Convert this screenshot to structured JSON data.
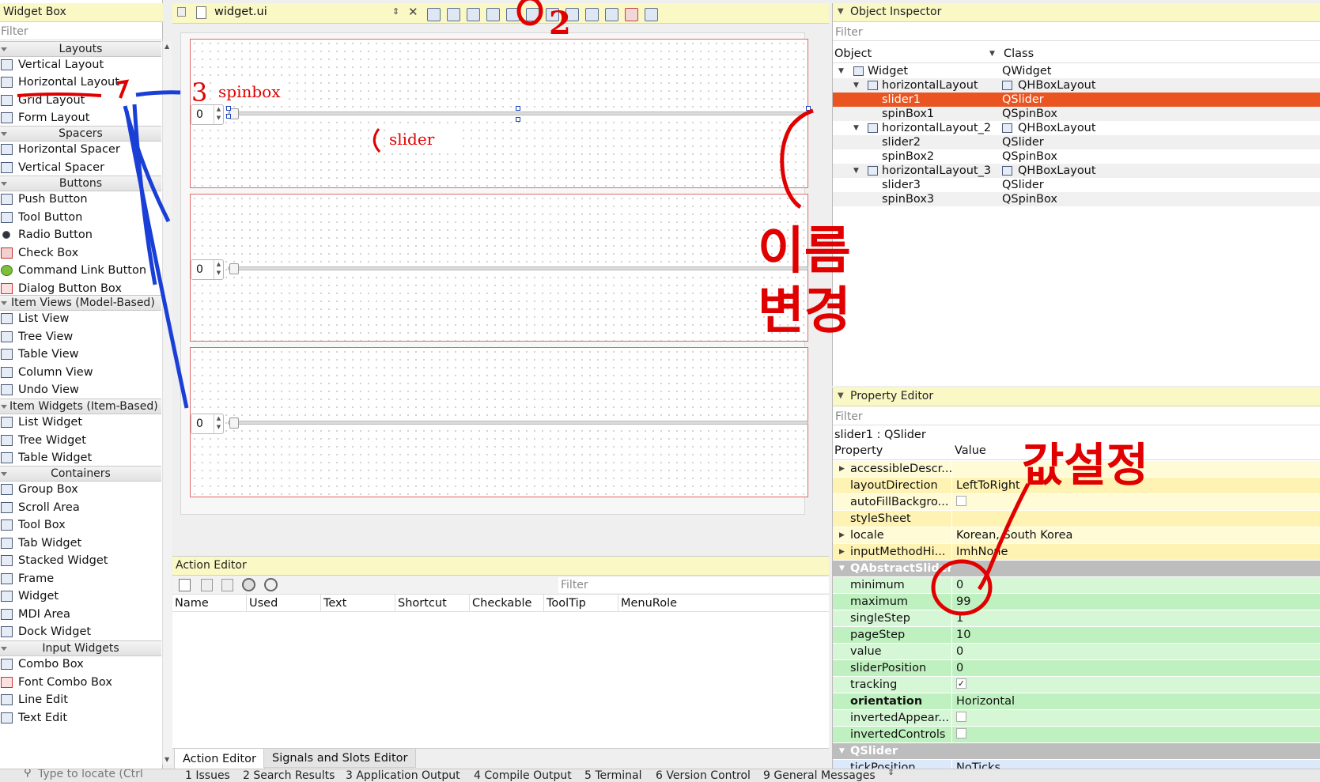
{
  "widget_box": {
    "title": "Widget Box",
    "filter_placeholder": "Filter",
    "categories": {
      "layouts": "Layouts",
      "spacers": "Spacers",
      "buttons": "Buttons",
      "item_views": "Item Views (Model-Based)",
      "item_widgets": "Item Widgets (Item-Based)",
      "containers": "Containers",
      "input_widgets": "Input Widgets"
    },
    "items": {
      "vertical_layout": "Vertical Layout",
      "horizontal_layout": "Horizontal Layout",
      "grid_layout": "Grid Layout",
      "form_layout": "Form Layout",
      "horizontal_spacer": "Horizontal Spacer",
      "vertical_spacer": "Vertical Spacer",
      "push_button": "Push Button",
      "tool_button": "Tool Button",
      "radio_button": "Radio Button",
      "check_box": "Check Box",
      "command_link_button": "Command Link Button",
      "dialog_button_box": "Dialog Button Box",
      "list_view": "List View",
      "tree_view": "Tree View",
      "table_view": "Table View",
      "column_view": "Column View",
      "undo_view": "Undo View",
      "list_widget": "List Widget",
      "tree_widget": "Tree Widget",
      "table_widget": "Table Widget",
      "group_box": "Group Box",
      "scroll_area": "Scroll Area",
      "tool_box": "Tool Box",
      "tab_widget": "Tab Widget",
      "stacked_widget": "Stacked Widget",
      "frame": "Frame",
      "widget": "Widget",
      "mdi_area": "MDI Area",
      "dock_widget": "Dock Widget",
      "combo_box": "Combo Box",
      "font_combo_box": "Font Combo Box",
      "line_edit": "Line Edit",
      "text_edit": "Text Edit"
    }
  },
  "editor": {
    "file_name": "widget.ui",
    "spin_values": [
      "0",
      "0",
      "0"
    ]
  },
  "action_editor": {
    "title": "Action Editor",
    "filter_placeholder": "Filter",
    "columns": {
      "name": "Name",
      "used": "Used",
      "text": "Text",
      "shortcut": "Shortcut",
      "checkable": "Checkable",
      "tooltip": "ToolTip",
      "menurole": "MenuRole"
    },
    "tabs": {
      "action_editor": "Action Editor",
      "signals_slots": "Signals and Slots Editor"
    }
  },
  "object_inspector": {
    "title": "Object Inspector",
    "filter_placeholder": "Filter",
    "col_object": "Object",
    "col_class": "Class",
    "rows": [
      {
        "object": "Widget",
        "class": "QWidget"
      },
      {
        "object": "horizontalLayout",
        "class": "QHBoxLayout"
      },
      {
        "object": "slider1",
        "class": "QSlider"
      },
      {
        "object": "spinBox1",
        "class": "QSpinBox"
      },
      {
        "object": "horizontalLayout_2",
        "class": "QHBoxLayout"
      },
      {
        "object": "slider2",
        "class": "QSlider"
      },
      {
        "object": "spinBox2",
        "class": "QSpinBox"
      },
      {
        "object": "horizontalLayout_3",
        "class": "QHBoxLayout"
      },
      {
        "object": "slider3",
        "class": "QSlider"
      },
      {
        "object": "spinBox3",
        "class": "QSpinBox"
      }
    ]
  },
  "property_editor": {
    "title": "Property Editor",
    "filter_placeholder": "Filter",
    "context": "slider1 : QSlider",
    "col_property": "Property",
    "col_value": "Value",
    "section_qabstractslider": "QAbstractSlider",
    "section_qslider": "QSlider",
    "props": {
      "accessible": {
        "name": "accessibleDescr...",
        "value": ""
      },
      "layoutDirection": {
        "name": "layoutDirection",
        "value": "LeftToRight"
      },
      "autoFill": {
        "name": "autoFillBackgro...",
        "value": ""
      },
      "styleSheet": {
        "name": "styleSheet",
        "value": ""
      },
      "locale": {
        "name": "locale",
        "value": "Korean, South Korea"
      },
      "inputMethod": {
        "name": "inputMethodHi...",
        "value": "ImhNone"
      },
      "minimum": {
        "name": "minimum",
        "value": "0"
      },
      "maximum": {
        "name": "maximum",
        "value": "99"
      },
      "singleStep": {
        "name": "singleStep",
        "value": "1"
      },
      "pageStep": {
        "name": "pageStep",
        "value": "10"
      },
      "value": {
        "name": "value",
        "value": "0"
      },
      "sliderPosition": {
        "name": "sliderPosition",
        "value": "0"
      },
      "tracking": {
        "name": "tracking",
        "value": "✓"
      },
      "orientation": {
        "name": "orientation",
        "value": "Horizontal"
      },
      "invertedAppearance": {
        "name": "invertedAppear...",
        "value": ""
      },
      "invertedControls": {
        "name": "invertedControls",
        "value": ""
      },
      "tickPosition": {
        "name": "tickPosition",
        "value": "NoTicks"
      }
    }
  },
  "bottom_bar": {
    "locate_placeholder": "Type to locate (Ctrl",
    "tabs": [
      "1  Issues",
      "2  Search Results",
      "3  Application Output",
      "4  Compile Output",
      "5  Terminal",
      "6  Version Control",
      "9  General Messages"
    ]
  },
  "annotations": {
    "step2": "2",
    "step3_num": "3",
    "spinbox": "spinbox",
    "slider": "slider",
    "korean_resize": "이름 변경",
    "korean_value": "값설정"
  },
  "colors": {
    "selection": "#e95420",
    "dock_title": "#faf8c4",
    "annotation_red": "#e00000",
    "annotation_blue": "#1a3fd6"
  }
}
